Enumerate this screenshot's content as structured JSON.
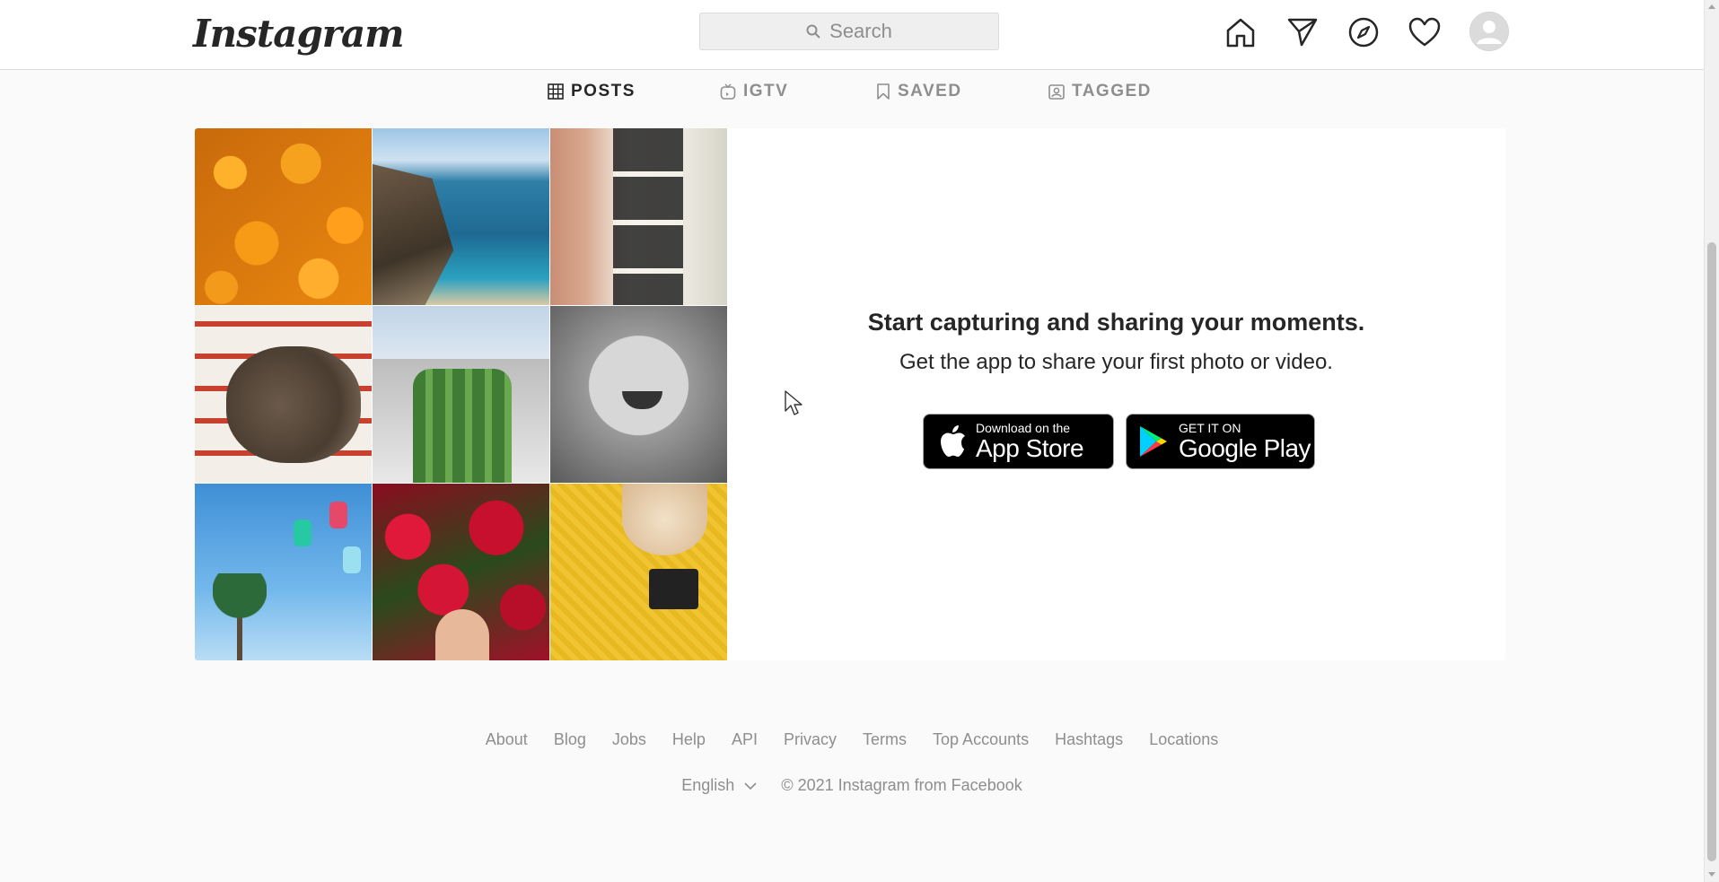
{
  "header": {
    "logo_text": "Instagram",
    "search_placeholder": "Search",
    "icons": [
      "home-icon",
      "direct-icon",
      "explore-icon",
      "activity-icon"
    ]
  },
  "tabs": [
    {
      "label": "POSTS",
      "icon": "grid-icon",
      "active": true
    },
    {
      "label": "IGTV",
      "icon": "igtv-icon",
      "active": false
    },
    {
      "label": "SAVED",
      "icon": "bookmark-icon",
      "active": false
    },
    {
      "label": "TAGGED",
      "icon": "tagged-icon",
      "active": false
    }
  ],
  "promo": {
    "title": "Start capturing and sharing your moments.",
    "subtitle": "Get the app to share your first photo or video.",
    "app_store": {
      "small": "Download on the",
      "big": "App Store"
    },
    "google_play": {
      "small": "GET IT ON",
      "big": "Google Play"
    }
  },
  "footer": {
    "links": [
      "About",
      "Blog",
      "Jobs",
      "Help",
      "API",
      "Privacy",
      "Terms",
      "Top Accounts",
      "Hashtags",
      "Locations"
    ],
    "language": "English",
    "copyright": "© 2021 Instagram from Facebook"
  },
  "colors": {
    "background": "#fafafa",
    "text": "#262626",
    "muted": "#8e8e8e",
    "border": "#dbdbdb"
  }
}
